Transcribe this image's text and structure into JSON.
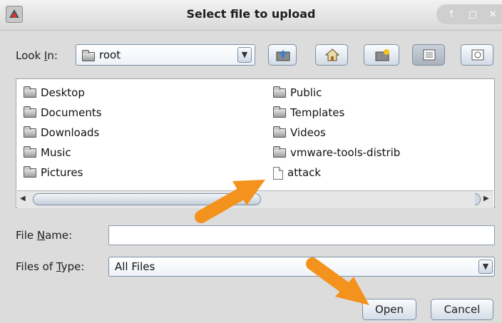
{
  "window": {
    "title": "Select file to upload",
    "controls": {
      "up": "↑",
      "maximize": "□",
      "close": "✕"
    }
  },
  "look_in": {
    "label_pre": "Look ",
    "label_mnemonic": "I",
    "label_post": "n:",
    "value": "root",
    "dropdown_glyph": "▼"
  },
  "toolbar": [
    "up-folder-icon",
    "home-icon",
    "new-folder-icon",
    "list-view-icon",
    "details-view-icon"
  ],
  "file_list": {
    "column1": [
      {
        "name": "Desktop",
        "type": "folder"
      },
      {
        "name": "Documents",
        "type": "folder"
      },
      {
        "name": "Downloads",
        "type": "folder"
      },
      {
        "name": "Music",
        "type": "folder"
      },
      {
        "name": "Pictures",
        "type": "folder"
      }
    ],
    "column2": [
      {
        "name": "Public",
        "type": "folder"
      },
      {
        "name": "Templates",
        "type": "folder"
      },
      {
        "name": "Videos",
        "type": "folder"
      },
      {
        "name": "vmware-tools-distrib",
        "type": "folder"
      },
      {
        "name": "attack",
        "type": "file"
      }
    ],
    "scroll_left": "◀",
    "scroll_right": "▶"
  },
  "file_name": {
    "label_pre": "File ",
    "label_mnemonic": "N",
    "label_post": "ame:",
    "value": ""
  },
  "files_of_type": {
    "label_pre": "Files of ",
    "label_mnemonic": "T",
    "label_post": "ype:",
    "value": "All Files",
    "dropdown_glyph": "▼"
  },
  "buttons": {
    "open": "Open",
    "cancel": "Cancel"
  },
  "colors": {
    "arrow": "#f3921d",
    "list_bg": "#ffffff",
    "dialog_bg": "#dcdcdc"
  }
}
